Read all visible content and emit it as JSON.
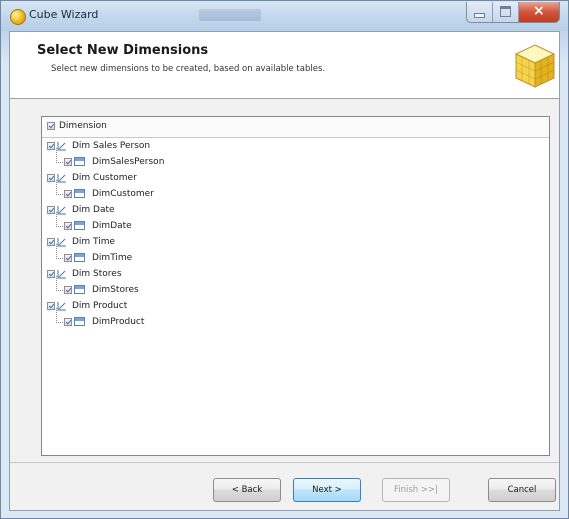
{
  "window": {
    "title": "Cube Wizard"
  },
  "header": {
    "title": "Select New Dimensions",
    "subtitle": "Select new dimensions to be created, based on available tables.",
    "icon": "cube-icon"
  },
  "dimension_list": {
    "header_label": "Dimension",
    "header_checked": true,
    "items": [
      {
        "label": "Dim Sales Person",
        "checked": true,
        "child": {
          "label": "DimSalesPerson",
          "checked": true
        }
      },
      {
        "label": "Dim Customer",
        "checked": true,
        "child": {
          "label": "DimCustomer",
          "checked": true
        }
      },
      {
        "label": "Dim Date",
        "checked": true,
        "child": {
          "label": "DimDate",
          "checked": true
        }
      },
      {
        "label": "Dim Time",
        "checked": true,
        "child": {
          "label": "DimTime",
          "checked": true
        }
      },
      {
        "label": "Dim Stores",
        "checked": true,
        "child": {
          "label": "DimStores",
          "checked": true
        }
      },
      {
        "label": "Dim Product",
        "checked": true,
        "child": {
          "label": "DimProduct",
          "checked": true
        }
      }
    ]
  },
  "buttons": {
    "back": "< Back",
    "next": "Next >",
    "finish": "Finish >>|",
    "cancel": "Cancel",
    "finish_enabled": false
  },
  "colors": {
    "title_bar": "#c2d7ec",
    "close_button": "#c13c21",
    "next_button_accent": "#3c7fb1",
    "table_icon": "#5b7fb8"
  }
}
